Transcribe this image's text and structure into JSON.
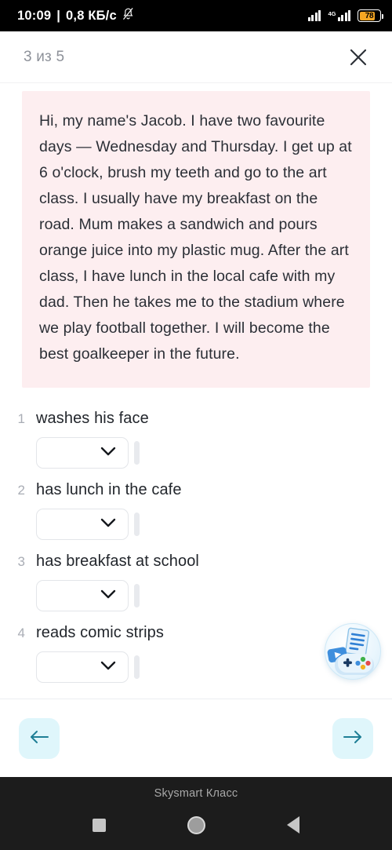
{
  "status_bar": {
    "time": "10:09",
    "separator": "|",
    "data_rate": "0,8 КБ/с",
    "mute_icon": "bell-muted-icon",
    "network_label": "4G",
    "battery_percent": "78",
    "battery_color": "#f5a623"
  },
  "header": {
    "progress_label": "3 из 5",
    "close_icon": "close-icon"
  },
  "passage": {
    "text": "Hi, my name's Jacob. I have two favourite days — Wednesday and Thursday. I get up at 6 o'clock, brush my teeth and go to the art class. I usually have my breakfast on the road. Mum makes a sandwich and pours orange juice into my plastic mug. After the art class, I have lunch in the local cafe with my dad. Then he takes me to the stadium where we play football together. I will become the best goalkeeper in the future.",
    "background_color": "#fdeef0"
  },
  "questions": [
    {
      "number": "1",
      "text": "washes his face",
      "answer": "",
      "dropdown_icon": "chevron-down-icon"
    },
    {
      "number": "2",
      "text": "has lunch in the cafe",
      "answer": "",
      "dropdown_icon": "chevron-down-icon"
    },
    {
      "number": "3",
      "text": "has breakfast at school",
      "answer": "",
      "dropdown_icon": "chevron-down-icon"
    },
    {
      "number": "4",
      "text": "reads comic strips",
      "answer": "",
      "dropdown_icon": "chevron-down-icon"
    }
  ],
  "fab": {
    "icon": "games-materials-icon"
  },
  "footer": {
    "prev_icon": "arrow-left-icon",
    "next_icon": "arrow-right-icon",
    "button_color": "#dff6fb",
    "arrow_color": "#1f7f96"
  },
  "android_nav": {
    "app_label": "Skysmart Класс",
    "recents_icon": "square-icon",
    "home_icon": "circle-icon",
    "back_icon": "triangle-back-icon"
  }
}
